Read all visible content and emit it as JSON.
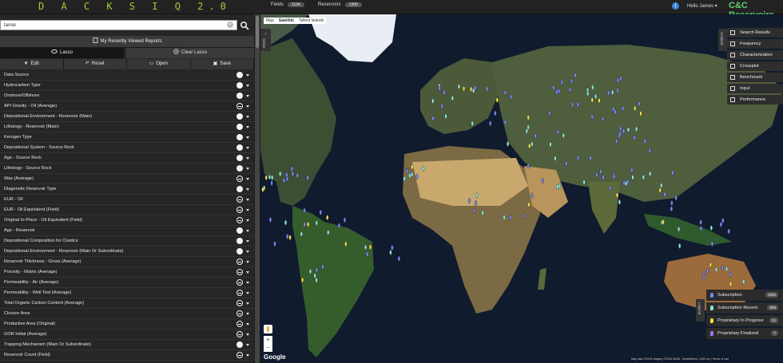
{
  "header": {
    "logo": "D A C K S  I Q 2.0",
    "fields_label": "Fields",
    "fields_count": "1134",
    "reservoirs_label": "Reservoirs",
    "reservoirs_count": "1300",
    "user_greeting": "Hello James ▾",
    "brand": "C&C Reservoirs"
  },
  "search": {
    "value": "tamar",
    "clear_glyph": "×"
  },
  "sidebar": {
    "recent_reports": "My Recently Viewed Reports",
    "lasso_label": "Lasso",
    "clear_lasso_label": "Clear Lasso",
    "tools": [
      {
        "name": "edit",
        "label": "Edit",
        "icon": "filter-icon"
      },
      {
        "name": "reset",
        "label": "Reset",
        "icon": "undo-icon"
      },
      {
        "name": "open",
        "label": "Open",
        "icon": "folder-icon"
      },
      {
        "name": "save",
        "label": "Save",
        "icon": "save-icon"
      }
    ],
    "filters": [
      {
        "label": "Data Source",
        "type": "pie"
      },
      {
        "label": "Hydrocarbon Type",
        "type": "pie"
      },
      {
        "label": "Onshore/Offshore",
        "type": "pie"
      },
      {
        "label": "API Gravity - Oil (Average)",
        "type": "range"
      },
      {
        "label": "Depositional Environment - Reservoir (Main)",
        "type": "pie"
      },
      {
        "label": "Lithology - Reservoir (Main)",
        "type": "pie"
      },
      {
        "label": "Kerogen Type",
        "type": "pie"
      },
      {
        "label": "Depositional System - Source Rock",
        "type": "pie"
      },
      {
        "label": "Age - Source Rock",
        "type": "pie"
      },
      {
        "label": "Lithology - Source Rock",
        "type": "pie"
      },
      {
        "label": "Wax (Average)",
        "type": "range"
      },
      {
        "label": "Diagenetic Reservoir Type",
        "type": "pie"
      },
      {
        "label": "EUR - Oil",
        "type": "range"
      },
      {
        "label": "EUR - Oil Equivalent (Field)",
        "type": "range"
      },
      {
        "label": "Original In-Place - Oil Equivalent (Field)",
        "type": "range"
      },
      {
        "label": "Age - Reservoir",
        "type": "pie"
      },
      {
        "label": "Depositional Composition for Clastics",
        "type": "pie"
      },
      {
        "label": "Depositional Environment - Reservoir (Main Or Subordinate)",
        "type": "pie"
      },
      {
        "label": "Reservoir Thickness - Gross (Average)",
        "type": "range"
      },
      {
        "label": "Porosity - Matrix (Average)",
        "type": "range"
      },
      {
        "label": "Permeability - Air (Average)",
        "type": "range"
      },
      {
        "label": "Permeability - Well Test (Average)",
        "type": "range"
      },
      {
        "label": "Total Organic Carbon Content (Average)",
        "type": "range"
      },
      {
        "label": "Closure Area",
        "type": "range"
      },
      {
        "label": "Productive Area (Original)",
        "type": "range"
      },
      {
        "label": "GOR Initial (Average)",
        "type": "range"
      },
      {
        "label": "Trapping Mechanism (Main Or Subordinate)",
        "type": "pie"
      },
      {
        "label": "Reservoir Count (Field)",
        "type": "range"
      }
    ]
  },
  "map": {
    "map_type_map": "Map",
    "map_type_satellite": "Satellite",
    "map_type_extra": "Tallest Islands",
    "select_tab": "Select",
    "analysis_tab": "Analysis",
    "legend_tab": "Legend",
    "google_label": "Google",
    "copyright": "Map data ©2018 Imagery ©2018 NASA, TerraMetrics | 1000 km | Terms of Use",
    "right_panel": [
      {
        "label": "Search Results",
        "icon": "table-icon"
      },
      {
        "label": "Frequency",
        "icon": "function-icon"
      },
      {
        "label": "Characterization",
        "icon": "bar-chart-icon"
      },
      {
        "label": "Crossplot",
        "icon": "scatter-icon"
      },
      {
        "label": "Benchmark",
        "icon": "benchmark-icon"
      },
      {
        "label": "Input",
        "icon": "input-icon"
      },
      {
        "label": "Performance",
        "icon": "gauge-icon"
      }
    ],
    "legend": [
      {
        "label": "Subscription",
        "count": "1052",
        "color": "#7b86f0"
      },
      {
        "label": "Subscription Recent",
        "count": "869",
        "color": "#8ee6d2"
      },
      {
        "label": "Proprietary In Progress",
        "count": "31",
        "color": "#f2e23a"
      },
      {
        "label": "Proprietary Finalized",
        "count": "7",
        "color": "#9b7cf0"
      }
    ]
  }
}
